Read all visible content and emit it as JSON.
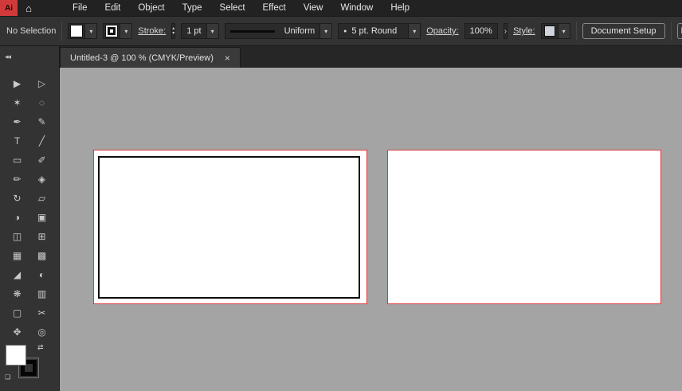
{
  "app": {
    "logo_text": "Ai"
  },
  "colors": {
    "artboard_selection_red": "#da3c3c",
    "canvas_gray": "#a4a4a4",
    "ui_dark": "#333333",
    "stroke_black": "#0d0d0d",
    "fill_white": "#ffffff"
  },
  "menubar": {
    "items": [
      "File",
      "Edit",
      "Object",
      "Type",
      "Select",
      "Effect",
      "View",
      "Window",
      "Help"
    ]
  },
  "control_bar": {
    "selection_status": "No Selection",
    "stroke_label": "Stroke:",
    "stroke_weight": "1 pt",
    "width_profile": "Uniform",
    "brush": "5 pt. Round",
    "opacity_label": "Opacity:",
    "opacity_value": "100%",
    "style_label": "Style:",
    "document_setup": "Document Setup",
    "preferences": "Pr"
  },
  "tabbar": {
    "active_tab_title": "Untitled-3 @ 100 % (CMYK/Preview)"
  },
  "icons": {
    "home": "⌂",
    "chevron_down": "▾",
    "stepper_up": "▴",
    "stepper_down": "▾",
    "arrow_right": "›",
    "close": "×",
    "collapse": "◂◂",
    "swap": "⇄",
    "brush_dot": "●",
    "default_swatches": "❏"
  },
  "toolbar": {
    "tools": [
      {
        "name": "selection",
        "glyph": "▶"
      },
      {
        "name": "direct-selection",
        "glyph": "▷"
      },
      {
        "name": "magic-wand",
        "glyph": "✶"
      },
      {
        "name": "lasso",
        "glyph": "◌"
      },
      {
        "name": "pen",
        "glyph": "✒"
      },
      {
        "name": "curvature",
        "glyph": "✎"
      },
      {
        "name": "type",
        "glyph": "T"
      },
      {
        "name": "line-segment",
        "glyph": "╱"
      },
      {
        "name": "rectangle",
        "glyph": "▭"
      },
      {
        "name": "paintbrush",
        "glyph": "✐"
      },
      {
        "name": "shaper",
        "glyph": "✏"
      },
      {
        "name": "eraser",
        "glyph": "◈"
      },
      {
        "name": "rotate",
        "glyph": "↻"
      },
      {
        "name": "scale",
        "glyph": "▱"
      },
      {
        "name": "width",
        "glyph": "◑"
      },
      {
        "name": "free-transform",
        "glyph": "▣"
      },
      {
        "name": "shape-builder",
        "glyph": "◫"
      },
      {
        "name": "perspective-grid",
        "glyph": "⊞"
      },
      {
        "name": "mesh",
        "glyph": "▦"
      },
      {
        "name": "gradient",
        "glyph": "▩"
      },
      {
        "name": "eyedropper",
        "glyph": "◢"
      },
      {
        "name": "blend",
        "glyph": "◐"
      },
      {
        "name": "symbol-sprayer",
        "glyph": "❋"
      },
      {
        "name": "column-graph",
        "glyph": "▥"
      },
      {
        "name": "artboard",
        "glyph": "▢"
      },
      {
        "name": "slice",
        "glyph": "✂"
      },
      {
        "name": "hand",
        "glyph": "✥"
      },
      {
        "name": "zoom",
        "glyph": "◎"
      }
    ]
  },
  "canvas": {
    "artboards": [
      {
        "id": 1,
        "has_black_rectangle": true
      },
      {
        "id": 2,
        "has_black_rectangle": false
      }
    ]
  }
}
